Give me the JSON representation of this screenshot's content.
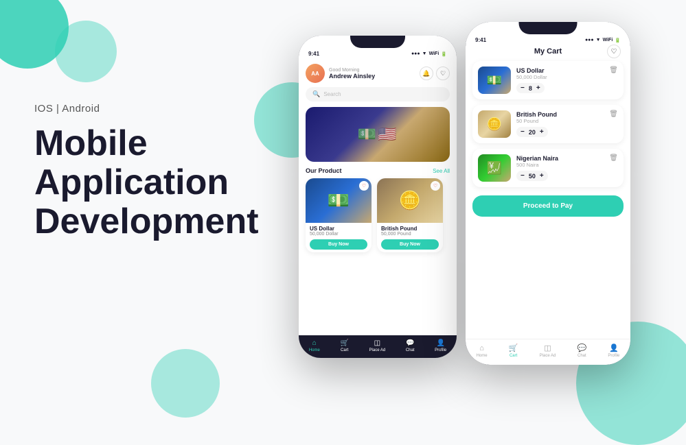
{
  "background": {
    "circles": [
      "tl",
      "tr",
      "mid",
      "bottom-left",
      "bottom-right"
    ]
  },
  "left_section": {
    "platform_label": "IOS  |  Android",
    "title_line1": "Mobile",
    "title_line2": "Application",
    "title_line3": "Development"
  },
  "phone1": {
    "status_bar": {
      "time": "9:41",
      "signal": "●●● ▼ WiFi 🔋"
    },
    "header": {
      "greeting": "Good Morning",
      "name": "Andrew Ainsley"
    },
    "search_placeholder": "Search",
    "section_title": "Our Product",
    "see_all": "See All",
    "products": [
      {
        "name": "US Dollar",
        "price": "50,000 Dollar",
        "buy_label": "Buy Now",
        "emoji": "💵"
      },
      {
        "name": "British Pound",
        "price": "50,000 Pound",
        "buy_label": "Buy Now",
        "emoji": "🪙"
      }
    ],
    "nav": [
      {
        "label": "Home",
        "icon": "⌂",
        "active": true
      },
      {
        "label": "Cart",
        "icon": "🛒",
        "active": false
      },
      {
        "label": "Place Ad",
        "icon": "◫",
        "active": false
      },
      {
        "label": "Chat",
        "icon": "💬",
        "active": false
      },
      {
        "label": "Profile",
        "icon": "👤",
        "active": false
      }
    ]
  },
  "phone2": {
    "status_bar": {
      "time": "9:41",
      "signal": "●●● ▼ WiFi 🔋"
    },
    "title": "My Cart",
    "cart_items": [
      {
        "name": "US Dollar",
        "sub": "50,000 Dollar",
        "qty": "8",
        "emoji": "💵",
        "img_class": "p2-item-img-usd"
      },
      {
        "name": "British Pound",
        "sub": "50 Pound",
        "qty": "20",
        "emoji": "🪙",
        "img_class": "p2-item-img-gbp"
      },
      {
        "name": "Nigerian Naira",
        "sub": "500 Naira",
        "qty": "50",
        "emoji": "💹",
        "img_class": "p2-item-img-ngn"
      }
    ],
    "proceed_label": "Proceed to Pay",
    "nav": [
      {
        "label": "Home",
        "icon": "⌂",
        "active": false
      },
      {
        "label": "Cart",
        "icon": "🛒",
        "active": true
      },
      {
        "label": "Place Ad",
        "icon": "◫",
        "active": false
      },
      {
        "label": "Chat",
        "icon": "💬",
        "active": false
      },
      {
        "label": "Profile",
        "icon": "👤",
        "active": false
      }
    ]
  }
}
